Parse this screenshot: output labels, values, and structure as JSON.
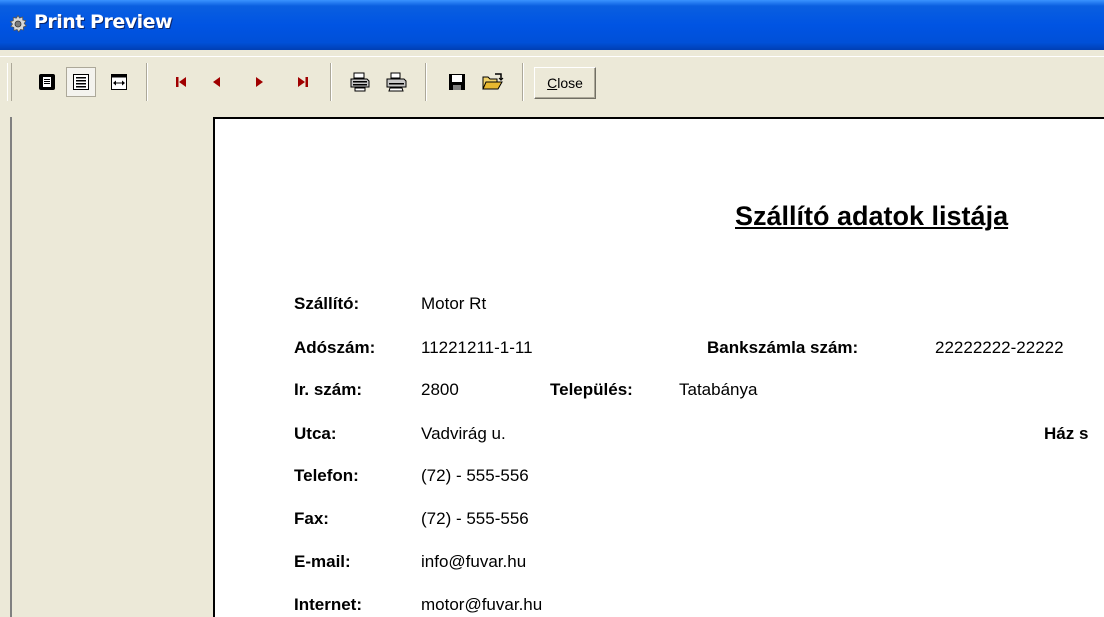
{
  "window": {
    "title": "Print Preview",
    "icon": "gear-icon",
    "title_bar_color": "#0054e3"
  },
  "toolbar": {
    "buttons": [
      {
        "name": "one-page-icon",
        "pressed": false
      },
      {
        "name": "whole-page-icon",
        "pressed": true
      },
      {
        "name": "fit-width-icon",
        "pressed": false
      },
      {
        "name": "first-page-icon",
        "pressed": false
      },
      {
        "name": "previous-page-icon",
        "pressed": false
      },
      {
        "name": "next-page-icon",
        "pressed": false
      },
      {
        "name": "last-page-icon",
        "pressed": false
      },
      {
        "name": "print-setup-icon",
        "pressed": false
      },
      {
        "name": "print-icon",
        "pressed": false
      },
      {
        "name": "save-icon",
        "pressed": false
      },
      {
        "name": "open-folder-icon",
        "pressed": false
      }
    ],
    "close_label_hotkey": "C",
    "close_label_rest": "lose"
  },
  "report": {
    "title": "Szállító adatok listája",
    "fields": {
      "szallito": {
        "label": "Szállító:",
        "value": "Motor Rt"
      },
      "adoszam": {
        "label": "Adószám:",
        "value": "11221211-1-11"
      },
      "bankszamla": {
        "label": "Bankszámla szám:",
        "value": "22222222-22222"
      },
      "irszam": {
        "label": "Ir. szám:",
        "value": "2800"
      },
      "telepules": {
        "label": "Település:",
        "value": "Tatabánya"
      },
      "utca": {
        "label": "Utca:",
        "value": "Vadvirág u."
      },
      "hazszam": {
        "label": "Ház s"
      },
      "telefon": {
        "label": "Telefon:",
        "value": "(72) - 555-556"
      },
      "fax": {
        "label": "Fax:",
        "value": "(72) - 555-556"
      },
      "email": {
        "label": "E-mail:",
        "value": "info@fuvar.hu"
      },
      "internet": {
        "label": "Internet:",
        "value": "motor@fuvar.hu"
      }
    }
  }
}
